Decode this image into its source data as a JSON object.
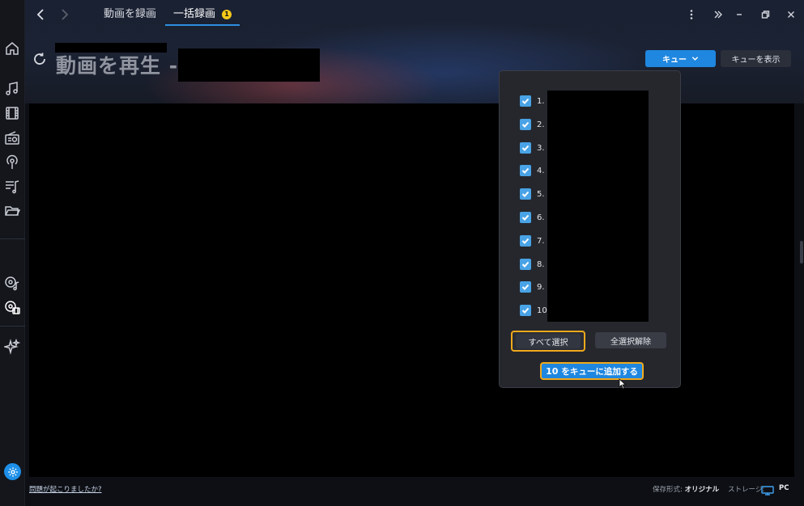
{
  "tabs": [
    {
      "label": "動画を録画"
    },
    {
      "label": "一括録画",
      "badge": "1"
    }
  ],
  "page": {
    "title": "動画を再生 -"
  },
  "header_buttons": {
    "queue": "キュー",
    "show_queue": "キューを表示"
  },
  "popup": {
    "items": [
      {
        "label": "1.",
        "checked": true
      },
      {
        "label": "2.",
        "checked": true
      },
      {
        "label": "3.",
        "checked": true
      },
      {
        "label": "4.",
        "checked": true
      },
      {
        "label": "5.",
        "checked": true
      },
      {
        "label": "6.",
        "checked": true
      },
      {
        "label": "7.",
        "checked": true
      },
      {
        "label": "8.",
        "checked": true
      },
      {
        "label": "9.",
        "checked": true
      },
      {
        "label": "10.",
        "checked": true
      }
    ],
    "select_all": "すべて選択",
    "deselect_all": "全選択解除",
    "add_count": "10",
    "add_label": "をキューに追加する"
  },
  "footer": {
    "problem_link": "問題が起こりましたか?",
    "save_format_label": "保存形式:",
    "save_format_value": "オリジナル",
    "storage_label": "ストレージ:",
    "storage_value": "PC"
  },
  "colors": {
    "accent": "#1f87e0",
    "highlight": "#f0a91c",
    "checkbox": "#49a3e6",
    "badge": "#f2c81a"
  }
}
